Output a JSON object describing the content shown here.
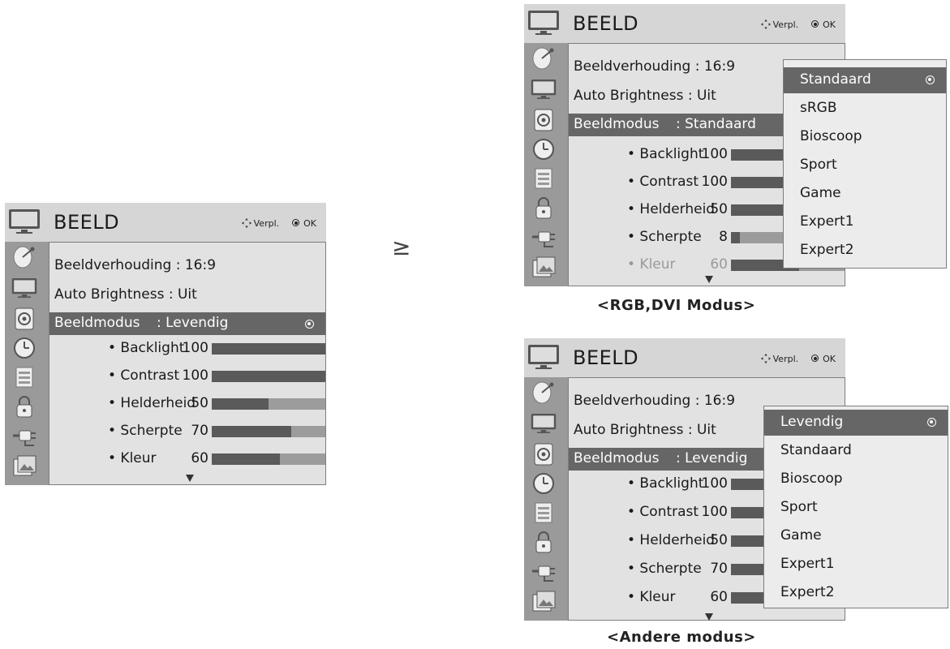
{
  "menu": {
    "title": "BEELD",
    "nav_label": "Verpl.",
    "ok_label": "OK",
    "aspect_label": "Beeldverhouding : 16:9",
    "auto_brightness_label": "Auto Brightness",
    "auto_brightness_value": ": Uit",
    "mode_label": "Beeldmodus",
    "colors": {
      "menu_bg": "#d6d6d6",
      "highlight": "#666666",
      "sidebar": "#9a9a9a"
    }
  },
  "left_menu": {
    "mode_value": ": Levendig",
    "settings": [
      {
        "name": "• Backlight",
        "value": "100",
        "level": 1.0
      },
      {
        "name": "• Contrast",
        "value": "100",
        "level": 1.0
      },
      {
        "name": "• Helderheid",
        "value": "50",
        "level": 0.5
      },
      {
        "name": "• Scherpte",
        "value": "70",
        "level": 0.7
      },
      {
        "name": "• Kleur",
        "value": "60",
        "level": 0.6
      }
    ]
  },
  "arrow_symbol": "≥",
  "rgb_menu": {
    "mode_value": ": Standaard",
    "settings": [
      {
        "name": "• Backlight",
        "value": "100",
        "level": 1.0
      },
      {
        "name": "• Contrast",
        "value": "100",
        "level": 1.0
      },
      {
        "name": "• Helderheid",
        "value": "50",
        "level": 0.5
      },
      {
        "name": "• Scherpte",
        "value": "8",
        "level": 0.08
      },
      {
        "name": "• Kleur",
        "value": "60",
        "level": 0.6
      }
    ],
    "dropdown": [
      "Standaard",
      "sRGB",
      "Bioscoop",
      "Sport",
      "Game",
      "Expert1",
      "Expert2"
    ],
    "caption": "<RGB,DVI Modus>"
  },
  "other_menu": {
    "mode_value": ": Levendig",
    "settings": [
      {
        "name": "• Backlight",
        "value": "100",
        "level": 1.0
      },
      {
        "name": "• Contrast",
        "value": "100",
        "level": 1.0
      },
      {
        "name": "• Helderheid",
        "value": "50",
        "level": 0.5
      },
      {
        "name": "• Scherpte",
        "value": "70",
        "level": 0.7
      },
      {
        "name": "• Kleur",
        "value": "60",
        "level": 0.6
      }
    ],
    "dropdown": [
      "Levendig",
      "Standaard",
      "Bioscoop",
      "Sport",
      "Game",
      "Expert1",
      "Expert2"
    ],
    "caption": "<Andere modus>"
  },
  "sidebar_icons": [
    "satellite-dish-icon",
    "tv-picture-icon",
    "audio-speaker-icon",
    "clock-icon",
    "option-box-icon",
    "lock-icon",
    "input-plug-icon",
    "photo-media-icon"
  ]
}
